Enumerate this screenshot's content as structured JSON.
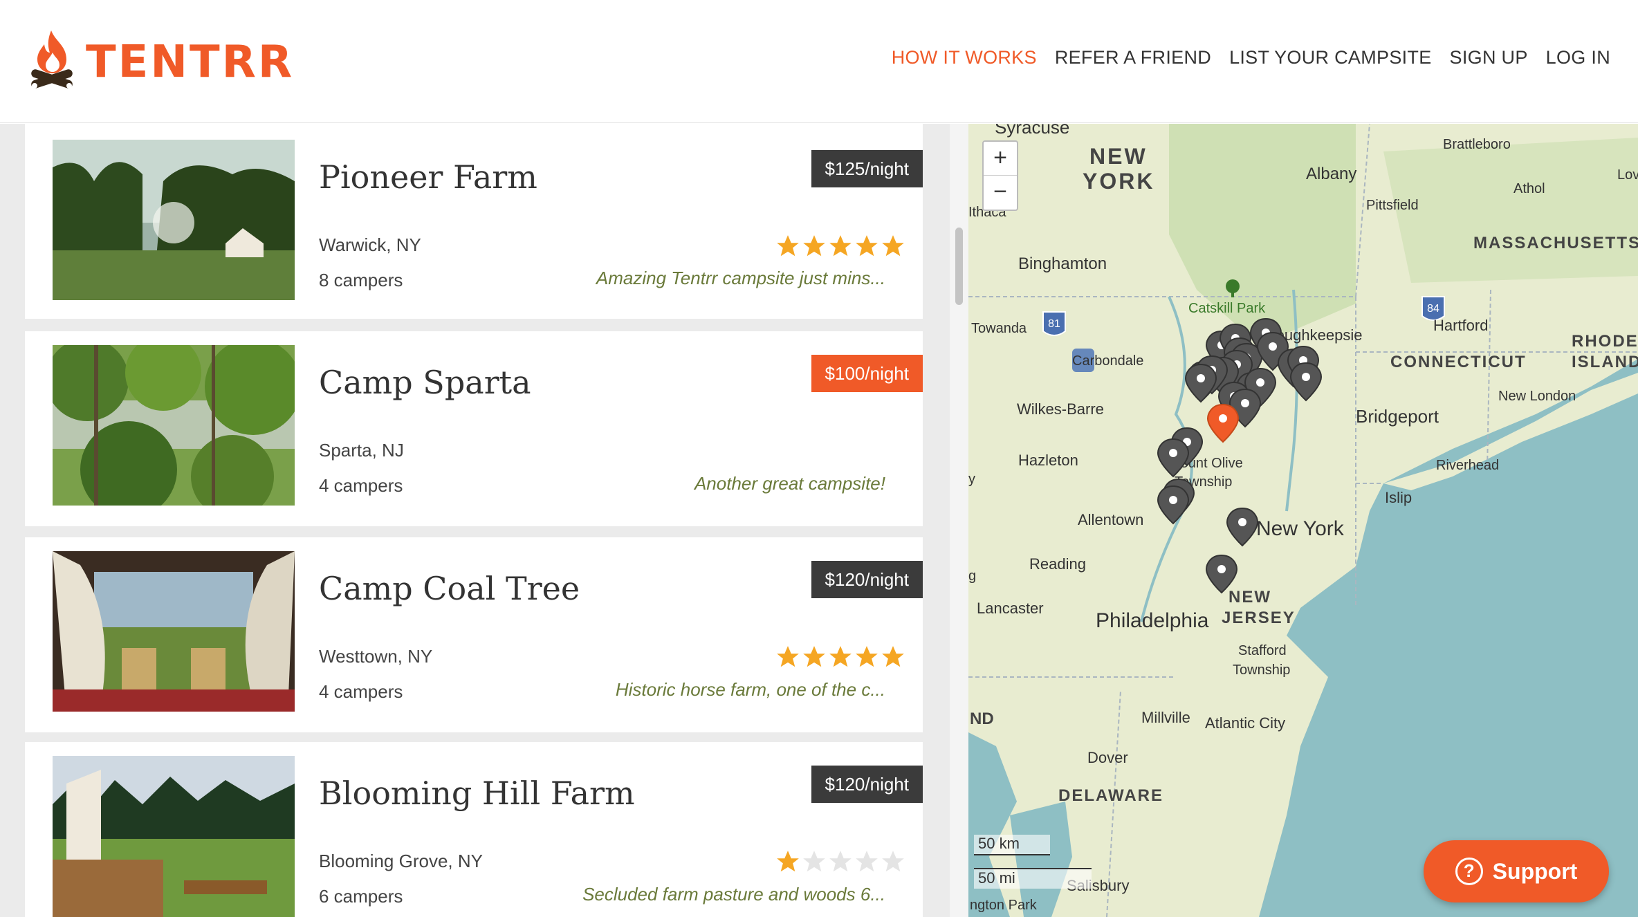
{
  "brand": {
    "name": "TENTRR",
    "color": "#f05a28"
  },
  "nav": [
    {
      "label": "HOW IT WORKS",
      "active": true
    },
    {
      "label": "REFER A FRIEND",
      "active": false
    },
    {
      "label": "LIST YOUR CAMPSITE",
      "active": false
    },
    {
      "label": "SIGN UP",
      "active": false
    },
    {
      "label": "LOG IN",
      "active": false
    }
  ],
  "listings": [
    {
      "name": "Pioneer Farm",
      "location": "Warwick, NY",
      "campers": "8 campers",
      "price": "$125/night",
      "highlighted": false,
      "rating": 5,
      "review": "Amazing Tentrr campsite just mins..."
    },
    {
      "name": "Camp Sparta",
      "location": "Sparta, NJ",
      "campers": "4 campers",
      "price": "$100/night",
      "highlighted": true,
      "rating": 0,
      "review": "Another great campsite!"
    },
    {
      "name": "Camp Coal Tree",
      "location": "Westtown, NY",
      "campers": "4 campers",
      "price": "$120/night",
      "highlighted": false,
      "rating": 5,
      "review": "Historic horse farm, one of the c..."
    },
    {
      "name": "Blooming Hill Farm",
      "location": "Blooming Grove, NY",
      "campers": "6 campers",
      "price": "$120/night",
      "highlighted": false,
      "rating": 1,
      "review": "Secluded farm pasture and woods 6..."
    }
  ],
  "map": {
    "zoom_in": "+",
    "zoom_out": "−",
    "scale_km": "50 km",
    "scale_mi": "50 mi",
    "labels": {
      "syracuse": "Syracuse",
      "new_york_state_1": "NEW",
      "new_york_state_2": "YORK",
      "albany": "Albany",
      "brattleboro": "Brattleboro",
      "athol": "Athol",
      "pittsfield": "Pittsfield",
      "massachusetts": "MASSACHUSETTS",
      "ithaca": "Ithaca",
      "binghamton": "Binghamton",
      "catskill": "Catskill Park",
      "poughkeepsie": "Poughkeepsie",
      "hartford": "Hartford",
      "rhode": "RHODE",
      "island": "ISLAND",
      "connecticut": "CONNECTICUT",
      "towanda": "Towanda",
      "carbondale": "Carbondale",
      "new_london": "New London",
      "wilkes_barre": "Wilkes-Barre",
      "bridgeport": "Bridgeport",
      "hazleton": "Hazleton",
      "mount_olive_1": "Mount Olive",
      "mount_olive_2": "Township",
      "riverhead": "Riverhead",
      "islip": "Islip",
      "allentown": "Allentown",
      "new_york_city": "New York",
      "reading": "Reading",
      "new_jersey_1": "NEW",
      "new_jersey_2": "JERSEY",
      "lancaster": "Lancaster",
      "philadelphia": "Philadelphia",
      "stafford_1": "Stafford",
      "stafford_2": "Township",
      "millville": "Millville",
      "atlantic_city": "Atlantic City",
      "nd": "ND",
      "dover": "Dover",
      "delaware": "DELAWARE",
      "salisbury": "Salisbury",
      "ngton_park": "ngton Park",
      "lov": "Lov",
      "i81": "81",
      "i84": "84",
      "edge_y": "y",
      "edge_g": "g"
    }
  },
  "support": {
    "label": "Support",
    "icon": "?"
  }
}
